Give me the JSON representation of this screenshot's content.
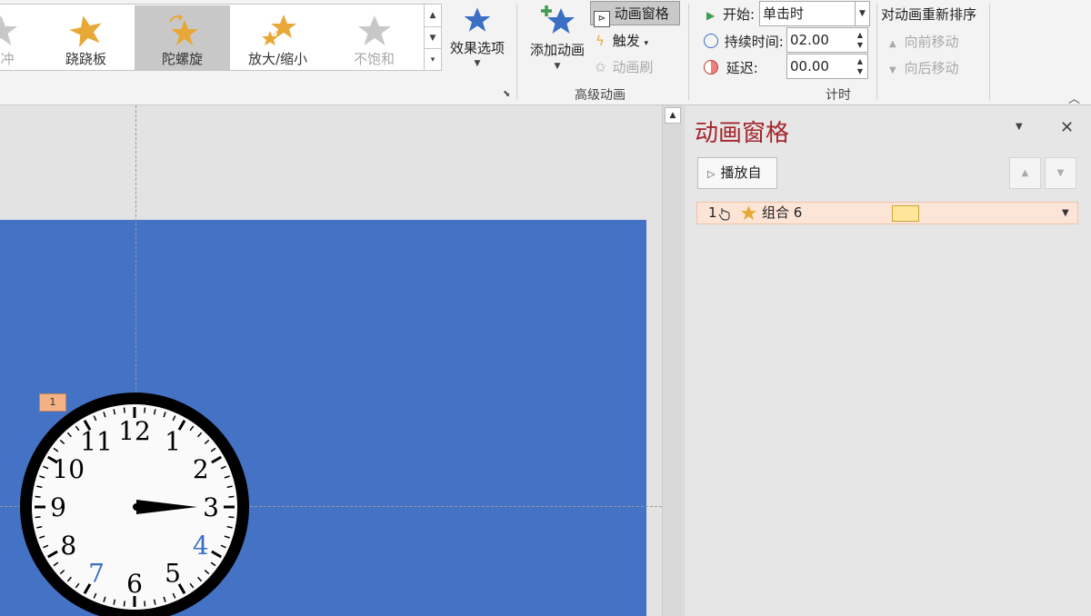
{
  "gallery": {
    "items": [
      {
        "label": "脉冲",
        "visible_label": "⋯冲",
        "icon": "pulse-star-icon",
        "state": "partial"
      },
      {
        "label": "跷跷板",
        "icon": "teeter-star-icon",
        "state": "normal"
      },
      {
        "label": "陀螺旋",
        "icon": "spin-star-icon",
        "state": "selected"
      },
      {
        "label": "放大/缩小",
        "icon": "grow-shrink-star-icon",
        "state": "normal"
      },
      {
        "label": "不饱和",
        "icon": "desaturate-star-icon",
        "state": "disabled"
      }
    ]
  },
  "effect_options": {
    "label": "效果选项"
  },
  "advanced": {
    "group_label": "高级动画",
    "add_animation": "添加动画",
    "animation_pane": "动画窗格",
    "trigger": "触发",
    "animation_painter": "动画刷"
  },
  "timing": {
    "group_label": "计时",
    "start_label": "开始:",
    "start_value": "单击时",
    "duration_label": "持续时间:",
    "duration_value": "02.00",
    "delay_label": "延迟:",
    "delay_value": "00.00",
    "reorder_title": "对动画重新排序",
    "move_earlier": "向前移动",
    "move_later": "向后移动"
  },
  "pane": {
    "title": "动画窗格",
    "play_from": "播放自",
    "items": [
      {
        "index": "1",
        "name": "组合 6"
      }
    ]
  },
  "slide": {
    "tag": "1",
    "clock_numbers": [
      "12",
      "1",
      "2",
      "3",
      "4",
      "5",
      "6",
      "7",
      "8",
      "9",
      "10",
      "11"
    ]
  },
  "colors": {
    "slide_bg": "#4472c4",
    "pane_title": "#a4262c",
    "star_gold": "#e8a838",
    "star_blue": "#3a6fc4",
    "selected_row": "#fce4d6"
  }
}
